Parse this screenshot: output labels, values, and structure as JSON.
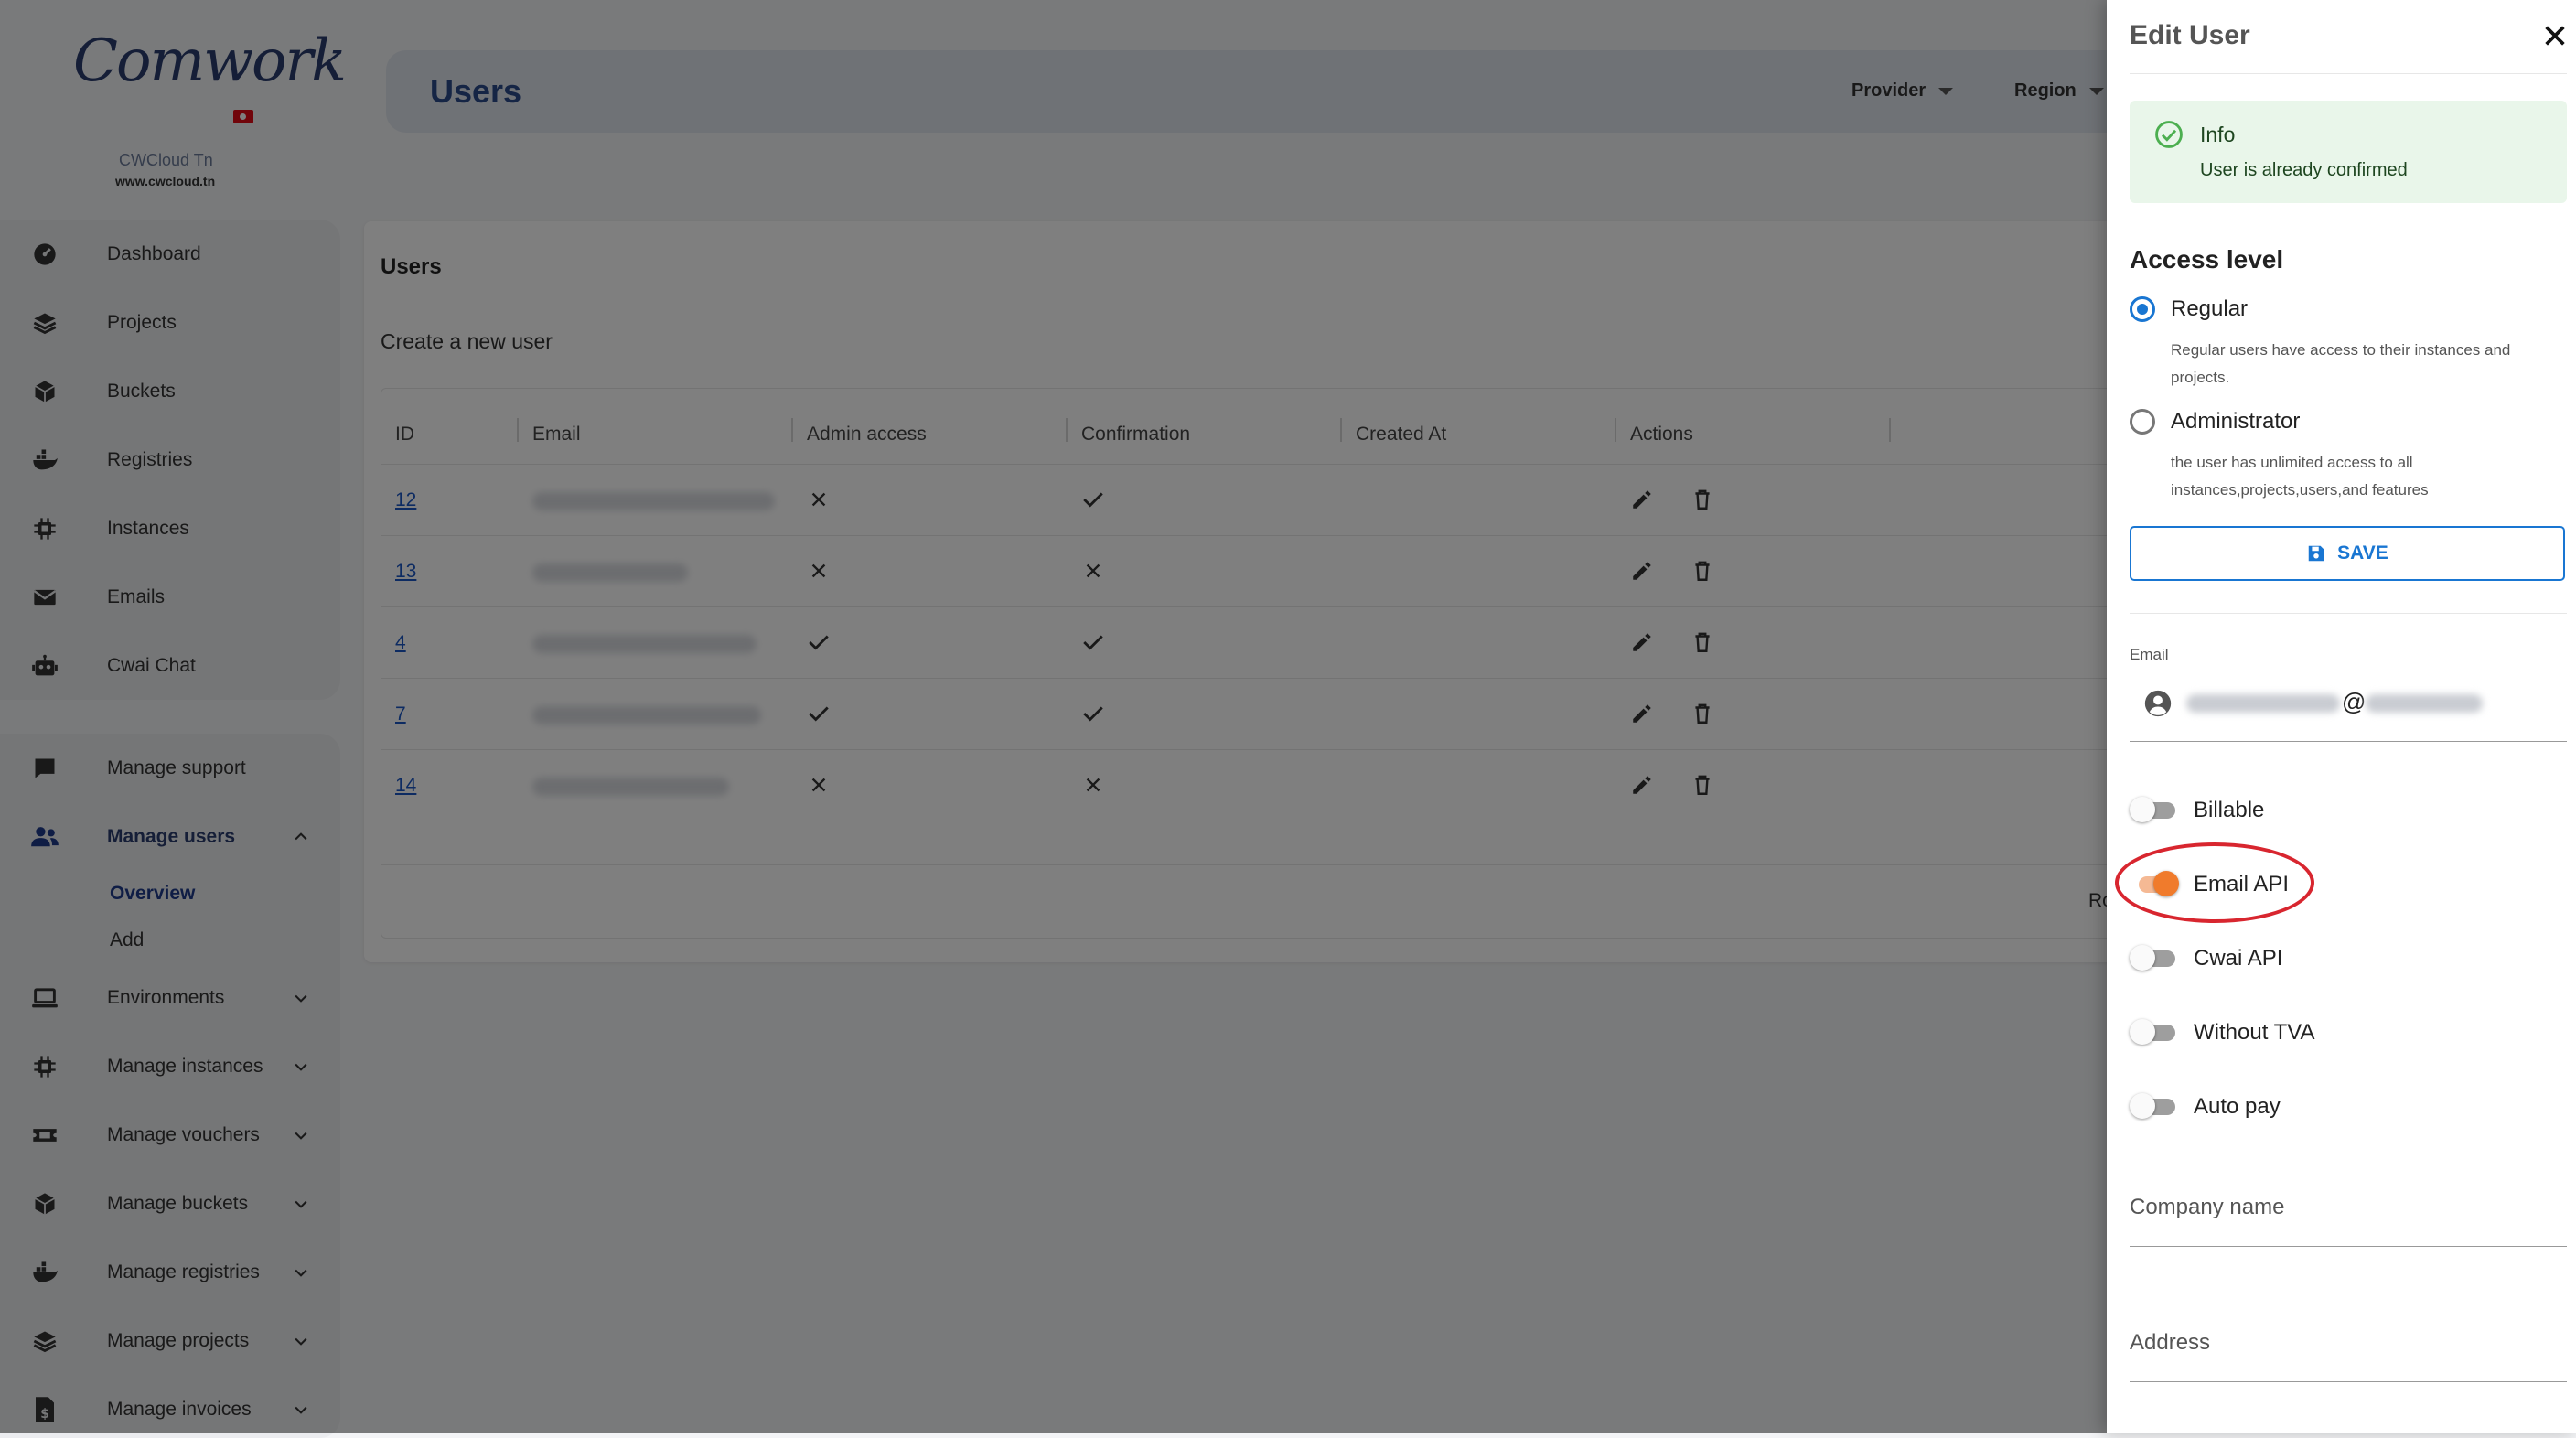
{
  "brand": {
    "logo_text": "Comwork",
    "name": "CWCloud Tn",
    "url": "www.cwcloud.tn"
  },
  "sidebar": {
    "primary": [
      {
        "label": "Dashboard",
        "icon": "dashboard-icon"
      },
      {
        "label": "Projects",
        "icon": "layers-icon"
      },
      {
        "label": "Buckets",
        "icon": "cube-icon"
      },
      {
        "label": "Registries",
        "icon": "docker-icon"
      },
      {
        "label": "Instances",
        "icon": "chip-icon"
      },
      {
        "label": "Emails",
        "icon": "envelope-icon"
      },
      {
        "label": "Cwai Chat",
        "icon": "robot-icon"
      }
    ],
    "manage": [
      {
        "label": "Manage support",
        "icon": "chat-icon"
      },
      {
        "label": "Manage users",
        "icon": "users-icon",
        "expanded": true
      },
      {
        "label": "Environments",
        "icon": "laptop-icon"
      },
      {
        "label": "Manage instances",
        "icon": "chip-icon"
      },
      {
        "label": "Manage vouchers",
        "icon": "ticket-icon"
      },
      {
        "label": "Manage buckets",
        "icon": "cube-icon"
      },
      {
        "label": "Manage registries",
        "icon": "docker-icon"
      },
      {
        "label": "Manage projects",
        "icon": "layers-icon"
      },
      {
        "label": "Manage invoices",
        "icon": "invoice-icon"
      }
    ],
    "users_sub": [
      {
        "label": "Overview",
        "active": true
      },
      {
        "label": "Add",
        "active": false
      }
    ]
  },
  "header": {
    "title": "Users",
    "provider_label": "Provider",
    "region_label": "Region"
  },
  "main": {
    "card_title": "Users",
    "create_link": "Create a new user",
    "columns": [
      "ID",
      "Email",
      "Admin access",
      "Confirmation",
      "Created At",
      "Actions"
    ],
    "rows": [
      {
        "id": "12",
        "admin": false,
        "confirmed": true
      },
      {
        "id": "13",
        "admin": false,
        "confirmed": false
      },
      {
        "id": "4",
        "admin": true,
        "confirmed": true
      },
      {
        "id": "7",
        "admin": true,
        "confirmed": true
      },
      {
        "id": "14",
        "admin": false,
        "confirmed": false
      }
    ],
    "rows_label": "Rov"
  },
  "drawer": {
    "title": "Edit User",
    "alert": {
      "title": "Info",
      "message": "User is already confirmed"
    },
    "access_title": "Access level",
    "options": [
      {
        "label": "Regular",
        "desc": "Regular users have access to their instances and projects.",
        "selected": true
      },
      {
        "label": "Administrator",
        "desc": "the user has unlimited access to all instances,projects,users,and features",
        "selected": false
      }
    ],
    "save_label": "SAVE",
    "email_label": "Email",
    "email_at": "@",
    "toggles": [
      {
        "label": "Billable",
        "on": false
      },
      {
        "label": "Email API",
        "on": true
      },
      {
        "label": "Cwai API",
        "on": false
      },
      {
        "label": "Without TVA",
        "on": false
      },
      {
        "label": "Auto pay",
        "on": false
      }
    ],
    "company_label": "Company name",
    "address_label": "Address"
  },
  "colors": {
    "accent": "#1976d2",
    "toggle_on": "#f07b2c",
    "highlight": "#d8262f",
    "brand": "#2a4a8a"
  }
}
